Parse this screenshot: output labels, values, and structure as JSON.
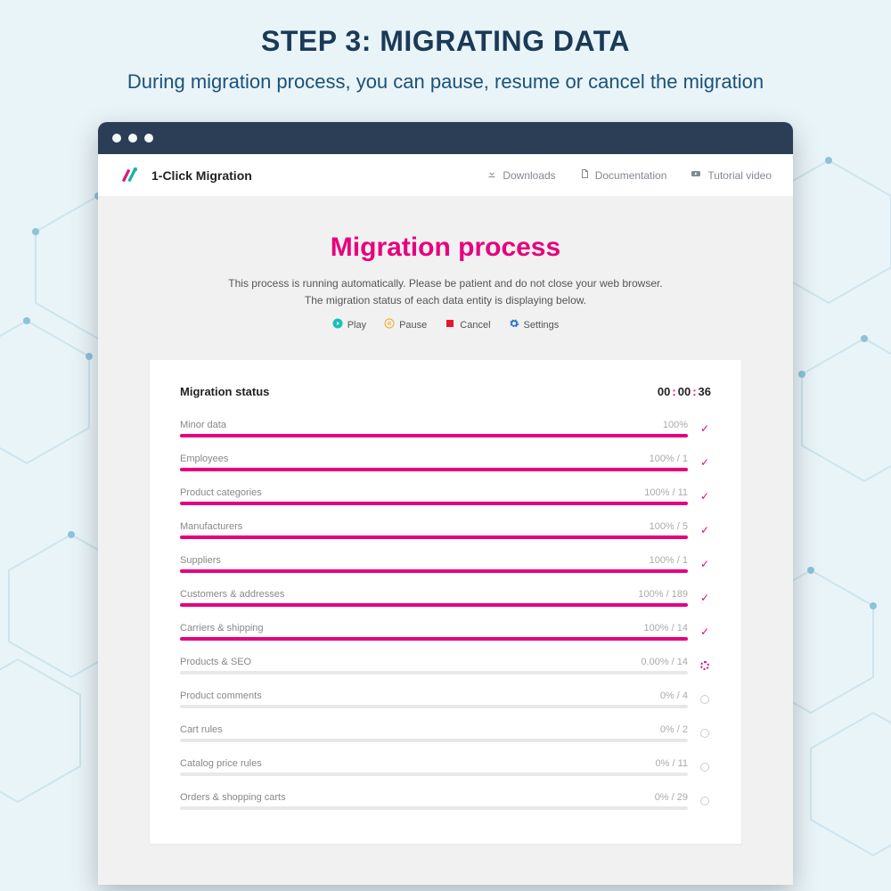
{
  "page": {
    "step_title": "STEP 3: MIGRATING DATA",
    "step_sub": "During migration process, you can pause, resume or cancel the migration"
  },
  "topnav": {
    "brand": "1-Click Migration",
    "links": {
      "downloads": "Downloads",
      "documentation": "Documentation",
      "tutorial": "Tutorial video"
    }
  },
  "main": {
    "title": "Migration process",
    "desc1": "This process is running automatically. Please be patient and do not close your web browser.",
    "desc2": "The migration status of each data entity is displaying below.",
    "controls": {
      "play": "Play",
      "pause": "Pause",
      "cancel": "Cancel",
      "settings": "Settings"
    }
  },
  "status_card": {
    "heading": "Migration status",
    "timer": {
      "h": "00",
      "m": "00",
      "s": "36"
    }
  },
  "rows": [
    {
      "label": "Minor data",
      "percent": "100%",
      "count": "",
      "fill": 100,
      "state": "done"
    },
    {
      "label": "Employees",
      "percent": "100%",
      "count": "1",
      "fill": 100,
      "state": "done"
    },
    {
      "label": "Product categories",
      "percent": "100%",
      "count": "11",
      "fill": 100,
      "state": "done"
    },
    {
      "label": "Manufacturers",
      "percent": "100%",
      "count": "5",
      "fill": 100,
      "state": "done"
    },
    {
      "label": "Suppliers",
      "percent": "100%",
      "count": "1",
      "fill": 100,
      "state": "done"
    },
    {
      "label": "Customers & addresses",
      "percent": "100%",
      "count": "189",
      "fill": 100,
      "state": "done"
    },
    {
      "label": "Carriers & shipping",
      "percent": "100%",
      "count": "14",
      "fill": 100,
      "state": "done"
    },
    {
      "label": "Products & SEO",
      "percent": "0.00%",
      "count": "14",
      "fill": 0,
      "state": "running"
    },
    {
      "label": "Product comments",
      "percent": "0%",
      "count": "4",
      "fill": 0,
      "state": "pending"
    },
    {
      "label": "Cart rules",
      "percent": "0%",
      "count": "2",
      "fill": 0,
      "state": "pending"
    },
    {
      "label": "Catalog price rules",
      "percent": "0%",
      "count": "11",
      "fill": 0,
      "state": "pending"
    },
    {
      "label": "Orders & shopping carts",
      "percent": "0%",
      "count": "29",
      "fill": 0,
      "state": "pending"
    }
  ]
}
